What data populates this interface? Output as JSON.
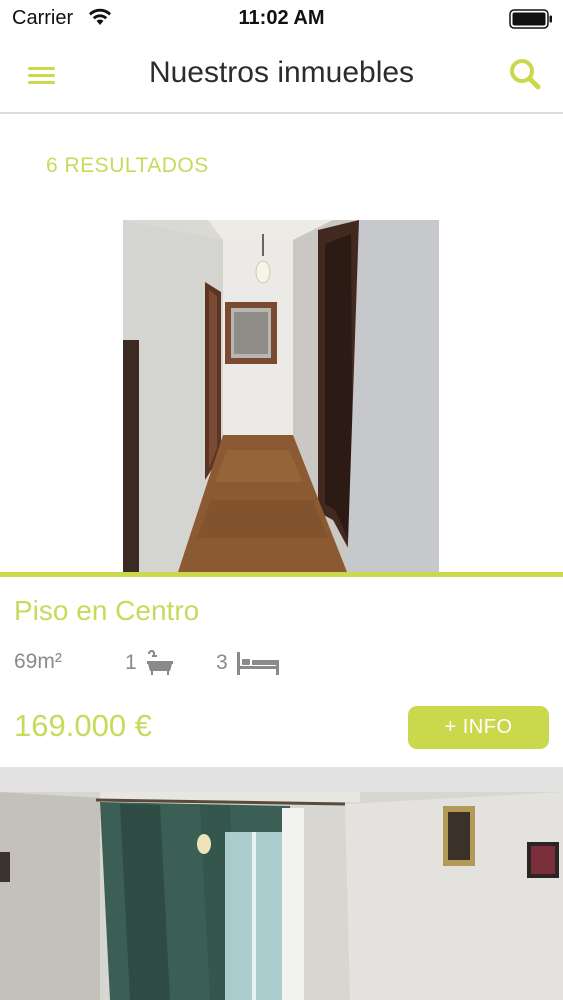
{
  "status_bar": {
    "carrier": "Carrier",
    "time": "11:02 AM"
  },
  "nav": {
    "title": "Nuestros inmuebles",
    "menu_icon": "hamburger-menu-icon",
    "search_icon": "search-icon"
  },
  "results": {
    "label": "6 RESULTADOS"
  },
  "listings": [
    {
      "title": "Piso en Centro",
      "area": "69m²",
      "bathrooms": "1",
      "bedrooms": "3",
      "price": "169.000 €",
      "button_label": "+ INFO",
      "image": "hallway-photo"
    },
    {
      "image": "bedroom-photo"
    }
  ],
  "colors": {
    "accent": "#c9d94b",
    "text_dark": "#2c2c2c",
    "text_muted": "#8a8a8a",
    "separator": "#e2e2e2"
  }
}
